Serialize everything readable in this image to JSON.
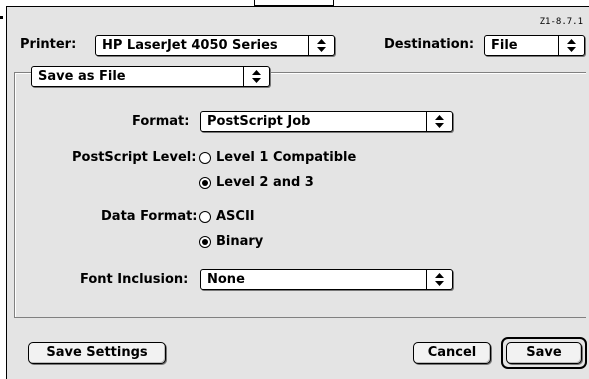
{
  "dialog": {
    "version_label": "Z1-8.7.1",
    "printer_label": "Printer:",
    "printer_value": "HP LaserJet 4050 Series",
    "destination_label": "Destination:",
    "destination_value": "File",
    "panel_value": "Save as File"
  },
  "options": {
    "format_label": "Format:",
    "format_value": "PostScript Job",
    "ps_level_label": "PostScript Level:",
    "ps_level_options": [
      {
        "label": "Level 1 Compatible",
        "selected": false
      },
      {
        "label": "Level 2 and 3",
        "selected": true
      }
    ],
    "data_format_label": "Data Format:",
    "data_format_options": [
      {
        "label": "ASCII",
        "selected": false
      },
      {
        "label": "Binary",
        "selected": true
      }
    ],
    "font_inclusion_label": "Font Inclusion:",
    "font_inclusion_value": "None"
  },
  "buttons": {
    "save_settings": "Save Settings",
    "cancel": "Cancel",
    "save": "Save"
  },
  "icons": {
    "popup_arrows": "up-down-arrows-icon"
  }
}
